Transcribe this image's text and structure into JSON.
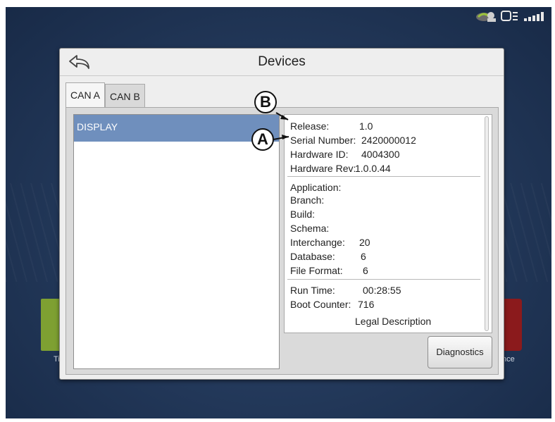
{
  "background": {
    "left_app_label": "Ti",
    "right_app_label": "nce"
  },
  "dialog": {
    "title": "Devices",
    "back_icon": "back-arrow-icon"
  },
  "tabs": [
    {
      "label": "CAN A",
      "active": true
    },
    {
      "label": "CAN B",
      "active": false
    }
  ],
  "devices": [
    {
      "name": "DISPLAY",
      "selected": true
    }
  ],
  "info": {
    "release_label": "Release:",
    "release_value": "1.0",
    "serial_label": "Serial Number:",
    "serial_value": "2420000012",
    "hwid_label": "Hardware ID:",
    "hwid_value": "4004300",
    "hwrev_label": "Hardware Rev:",
    "hwrev_value": "1.0.0.44",
    "application_label": "Application:",
    "branch_label": "Branch:",
    "build_label": "Build:",
    "schema_label": "Schema:",
    "interchange_label": "Interchange:",
    "interchange_value": "20",
    "database_label": "Database:",
    "database_value": "6",
    "fileformat_label": "File Format:",
    "fileformat_value": "6",
    "runtime_label": "Run Time:",
    "runtime_value": "00:28:55",
    "bootcounter_label": "Boot Counter:",
    "bootcounter_value": "716",
    "legal_label": "Legal Description"
  },
  "buttons": {
    "diagnostics": "Diagnostics"
  },
  "callouts": {
    "a": "A",
    "b": "B"
  },
  "colors": {
    "selected_row": "#6f8fbd",
    "background": "#243a5c"
  }
}
